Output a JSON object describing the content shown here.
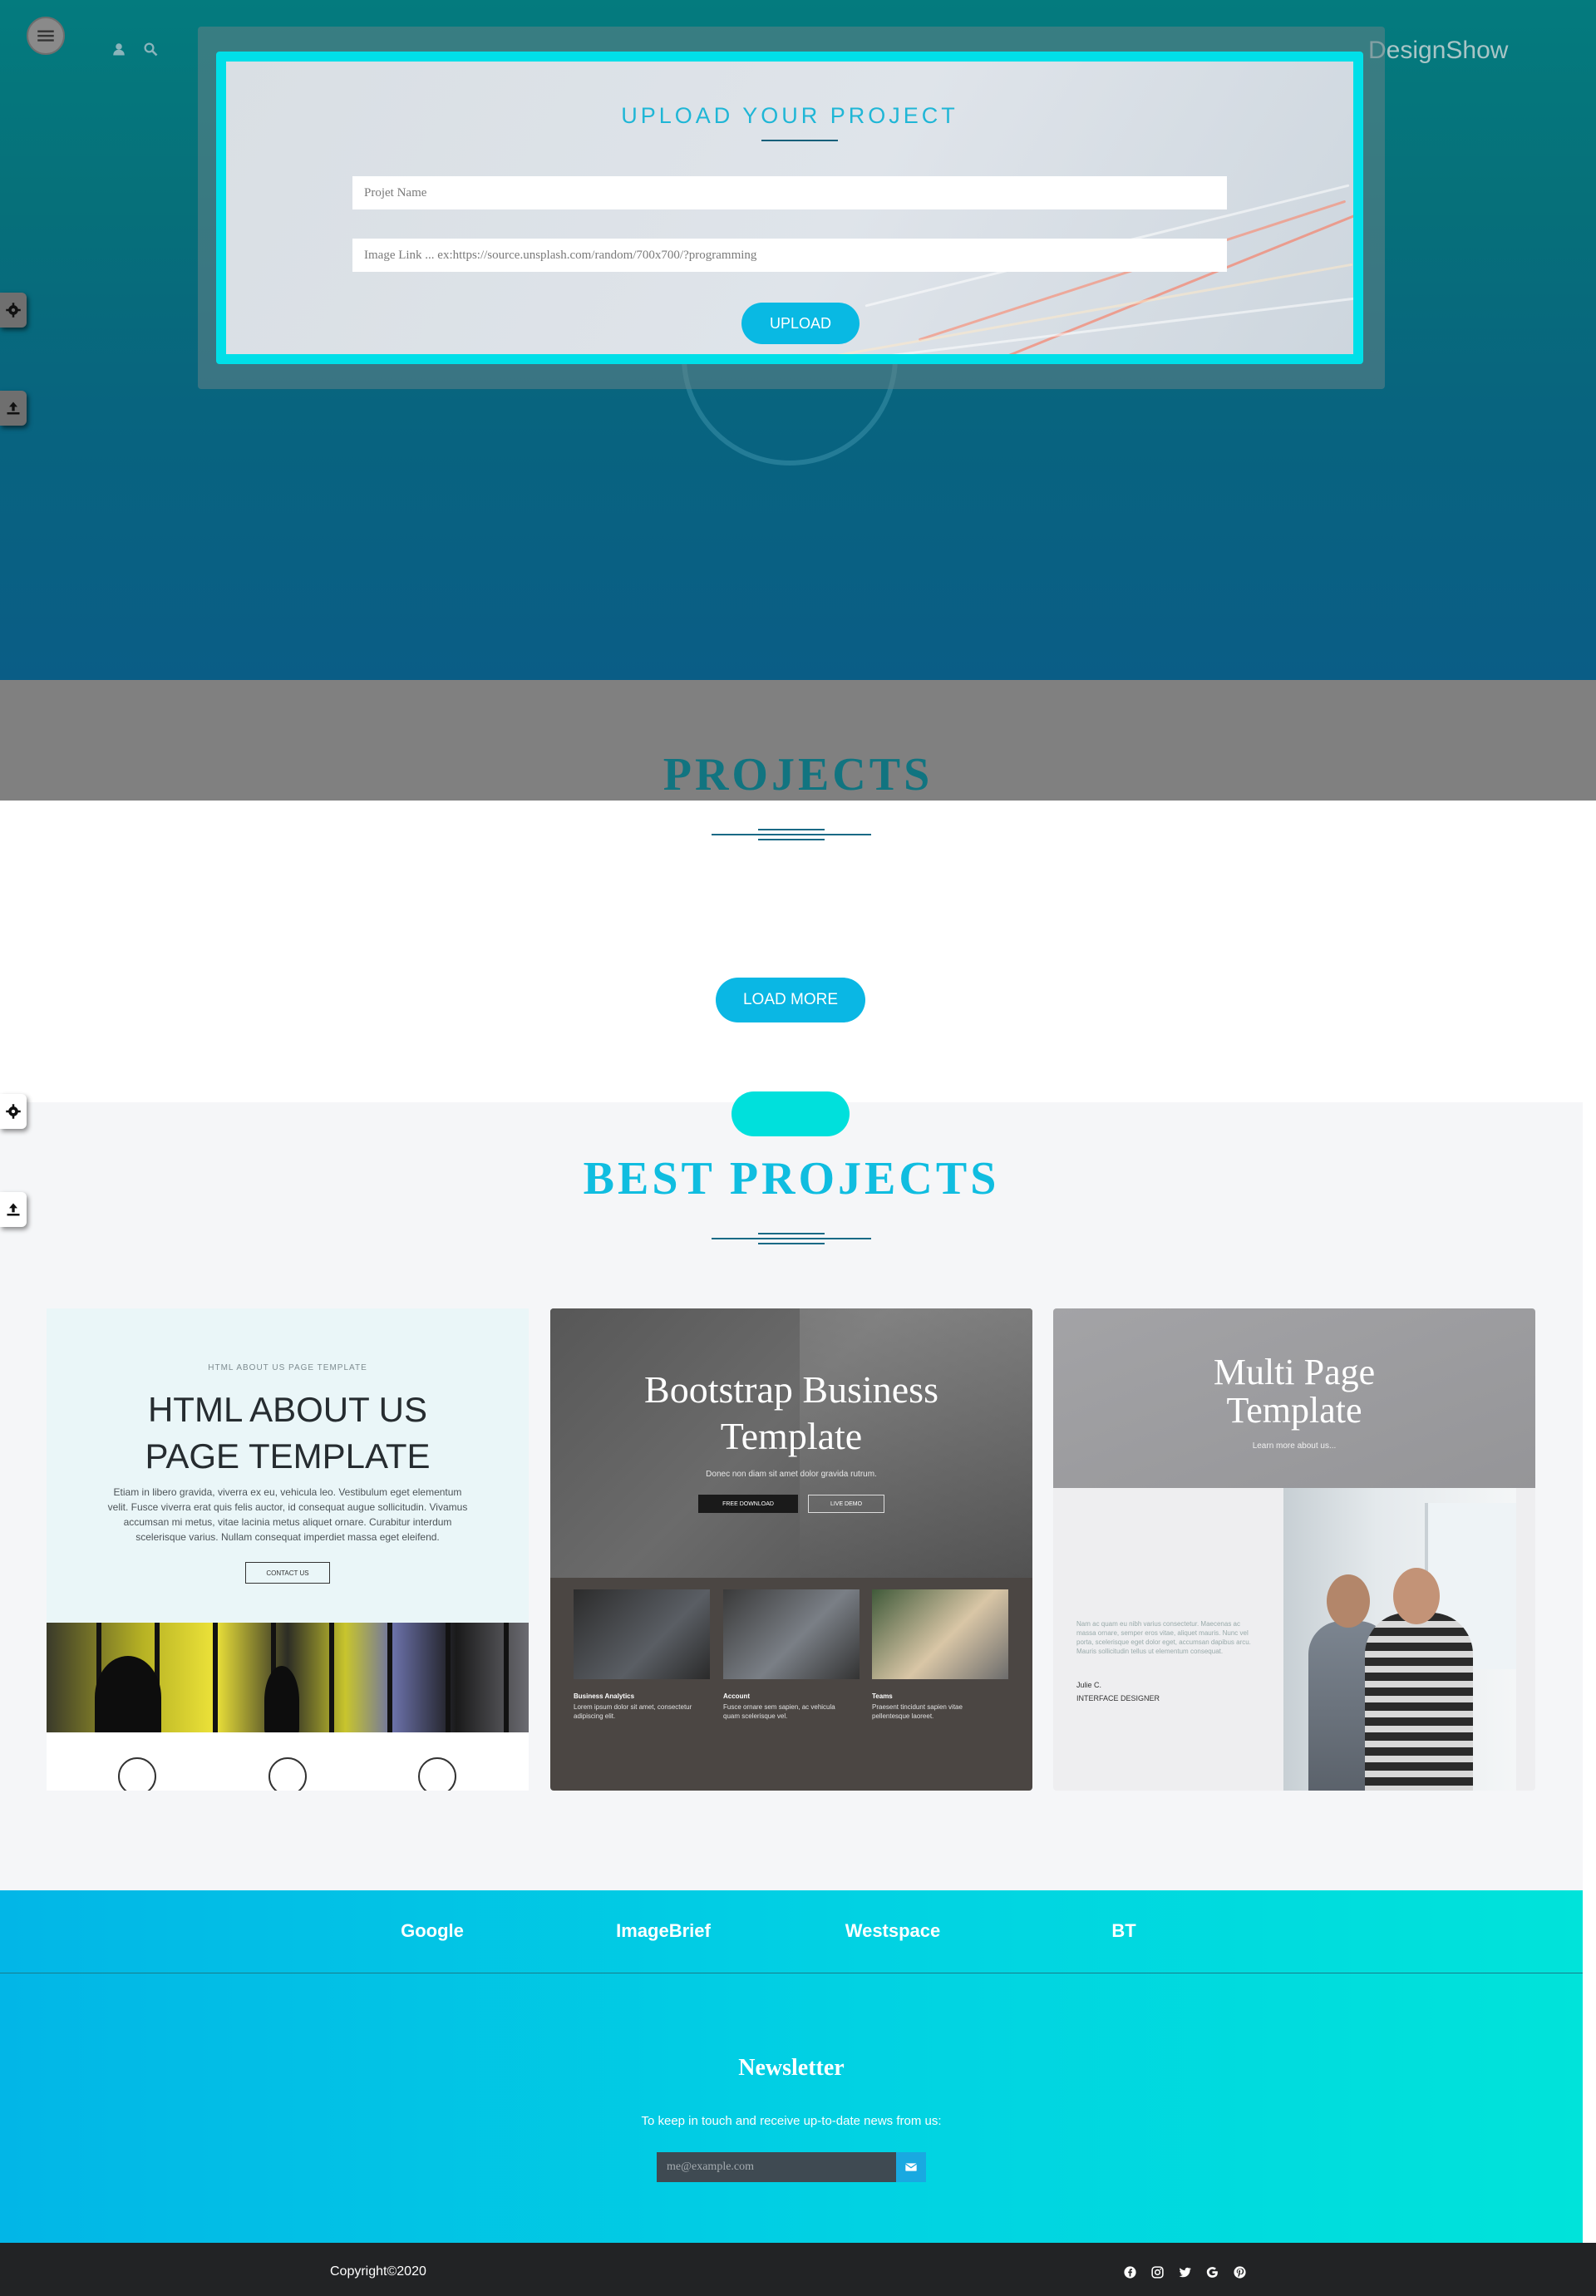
{
  "header": {
    "brand": "DesignShow",
    "menu_icon": "hamburger-icon",
    "user_icon": "user-icon",
    "search_icon": "search-icon"
  },
  "upload": {
    "title": "UPLOAD YOUR PROJECT",
    "name_placeholder": "Projet Name",
    "link_placeholder": "Image Link ... ex:https://source.unsplash.com/random/700x700/?programming",
    "button": "UPLOAD"
  },
  "side_tabs": {
    "settings_icon": "gear-icon",
    "upload_icon": "upload-icon"
  },
  "projects": {
    "title": "PROJECTS",
    "load_more": "LOAD MORE"
  },
  "best_projects": {
    "title": "BEST PROJECTS",
    "cards": [
      {
        "kicker": "HTML ABOUT US PAGE TEMPLATE",
        "title_line1": "HTML ABOUT US",
        "title_line2": "PAGE TEMPLATE",
        "body": "Etiam in libero gravida, viverra ex eu, vehicula leo. Vestibulum eget elementum velit. Fusce viverra erat quis felis auctor, id consequat augue sollicitudin. Vivamus accumsan mi metus, vitae lacinia metus aliquet ornare. Curabitur interdum scelerisque varius. Nullam consequat imperdiet massa eget eleifend.",
        "button": "CONTACT US"
      },
      {
        "title_line1": "Bootstrap Business",
        "title_line2": "Template",
        "subtitle": "Donec non diam sit amet dolor gravida rutrum.",
        "button_primary": "FREE DOWNLOAD",
        "button_secondary": "LIVE DEMO",
        "features": [
          {
            "title": "Business Analytics",
            "text": "Lorem ipsum dolor sit amet, consectetur adipiscing elit."
          },
          {
            "title": "Account",
            "text": "Fusce ornare sem sapien, ac vehicula quam scelerisque vel."
          },
          {
            "title": "Teams",
            "text": "Praesent tincidunt sapien vitae pellentesque laoreet."
          }
        ]
      },
      {
        "title_line1": "Multi Page",
        "title_line2": "Template",
        "subtitle": "Learn more about us...",
        "text": "Nam ac quam eu nibh varius consectetur. Maecenas ac massa ornare, semper eros vitae, aliquet mauris. Nunc vel porta, scelerisque eget dolor eget, accumsan dapibus arcu. Mauris sollicitudin tellus ut elementum consequat.",
        "name": "Julie C.",
        "role": "INTERFACE DESIGNER"
      }
    ]
  },
  "partners": [
    "Google",
    "ImageBrief",
    "Westspace",
    "BT"
  ],
  "newsletter": {
    "title": "Newsletter",
    "text": "To keep in touch and receive up-to-date news from us:",
    "placeholder": "me@example.com",
    "submit_icon": "envelope-icon"
  },
  "footer": {
    "copyright": "Copyright©2020",
    "socials": [
      "facebook-icon",
      "instagram-icon",
      "twitter-icon",
      "google-icon",
      "pinterest-icon"
    ]
  },
  "colors": {
    "accent": "#00dfe8",
    "button": "#09b9e3",
    "projects_title": "#117480",
    "best_title": "#10bde0"
  }
}
